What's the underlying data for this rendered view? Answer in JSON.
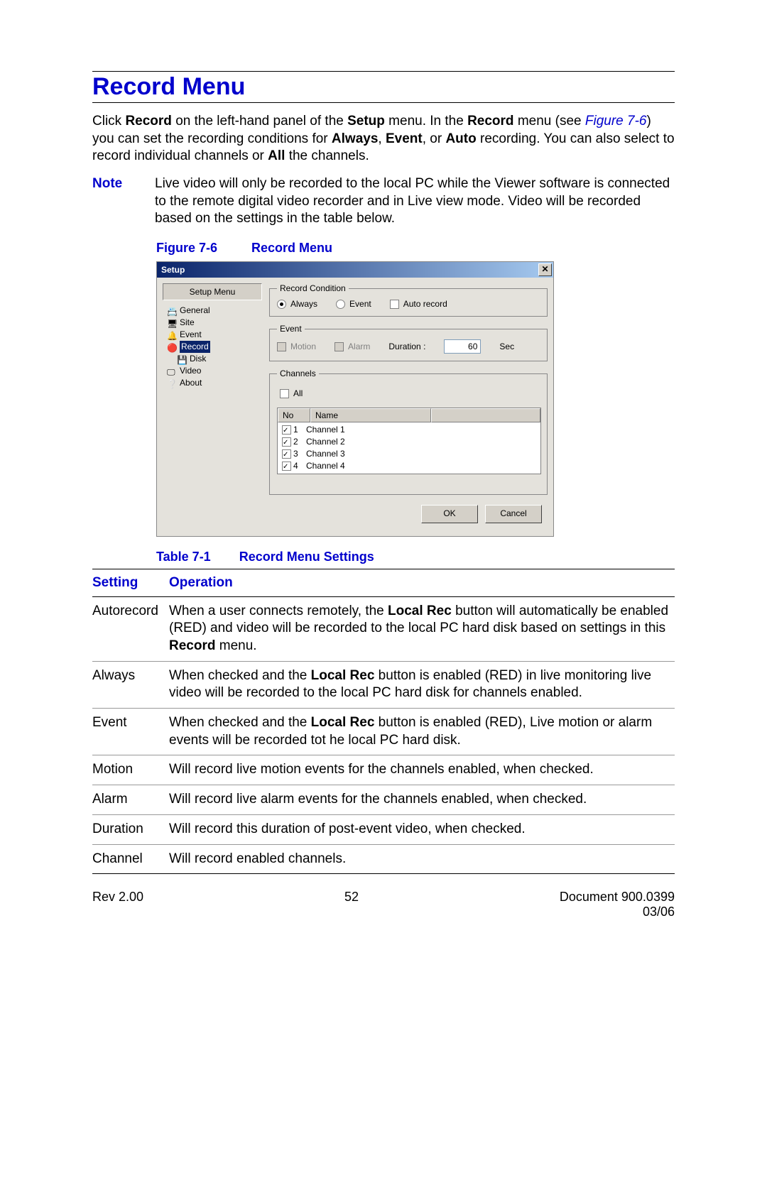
{
  "heading": "Record Menu",
  "intro": {
    "pre": "Click ",
    "b1": "Record",
    "mid1": " on the left-hand panel of the ",
    "b2": "Setup",
    "mid2": " menu. In the ",
    "b3": "Record",
    "mid3": " menu (see ",
    "figref": "Figure 7-6",
    "mid4": ") you can set the recording conditions for ",
    "b4": "Always",
    "c1": ", ",
    "b5": "Event",
    "c2": ", or ",
    "b6": "Auto",
    "mid5": " recording. You can also select to record individual channels or ",
    "b7": "All",
    "end": " the channels."
  },
  "note": {
    "label": "Note",
    "text": "Live video will only be recorded to the local PC while the Viewer software is connected to the remote digital video recorder and in Live view mode. Video will be recorded based on the settings in the table below."
  },
  "figure": {
    "num": "Figure 7-6",
    "title": "Record Menu"
  },
  "dialog": {
    "title": "Setup",
    "menuHeader": "Setup Menu",
    "tree": {
      "general": "General",
      "site": "Site",
      "event": "Event",
      "record": "Record",
      "disk": "Disk",
      "video": "Video",
      "about": "About"
    },
    "groups": {
      "recordCondition": "Record Condition",
      "event": "Event",
      "channels": "Channels"
    },
    "radios": {
      "always": "Always",
      "event": "Event",
      "autorecord": "Auto record"
    },
    "eventOpts": {
      "motion": "Motion",
      "alarm": "Alarm",
      "durationLabel": "Duration :",
      "durationValue": "60",
      "durationUnit": "Sec"
    },
    "channels": {
      "all": "All",
      "headers": {
        "no": "No",
        "name": "Name"
      },
      "rows": [
        {
          "no": "1",
          "name": "Channel 1"
        },
        {
          "no": "2",
          "name": "Channel 2"
        },
        {
          "no": "3",
          "name": "Channel 3"
        },
        {
          "no": "4",
          "name": "Channel 4"
        }
      ]
    },
    "buttons": {
      "ok": "OK",
      "cancel": "Cancel"
    }
  },
  "table": {
    "num": "Table 7-1",
    "title": "Record Menu Settings",
    "headers": {
      "setting": "Setting",
      "operation": "Operation"
    },
    "rows": [
      {
        "setting": "Autorecord",
        "op_pre": "When a user connects remotely, the ",
        "op_b1": "Local Rec",
        "op_mid": " button will automatically be enabled (RED) and video will be recorded to the local PC hard disk based on settings in this ",
        "op_b2": "Record",
        "op_end": " menu."
      },
      {
        "setting": "Always",
        "op_pre": "When checked and the ",
        "op_b1": "Local Rec",
        "op_mid": " button is enabled (RED) in live monitoring live video will be recorded to the local PC hard disk for channels enabled.",
        "op_b2": "",
        "op_end": ""
      },
      {
        "setting": "Event",
        "op_pre": "When checked and the ",
        "op_b1": "Local Rec",
        "op_mid": " button is enabled (RED), Live motion or alarm events will be recorded tot he local PC hard disk.",
        "op_b2": "",
        "op_end": ""
      },
      {
        "setting": "Motion",
        "op_pre": "Will record live motion events for the channels enabled, when checked.",
        "op_b1": "",
        "op_mid": "",
        "op_b2": "",
        "op_end": ""
      },
      {
        "setting": "Alarm",
        "op_pre": "Will record live alarm events for the channels enabled, when checked.",
        "op_b1": "",
        "op_mid": "",
        "op_b2": "",
        "op_end": ""
      },
      {
        "setting": "Duration",
        "op_pre": "Will record this duration of post-event video, when checked.",
        "op_b1": "",
        "op_mid": "",
        "op_b2": "",
        "op_end": ""
      },
      {
        "setting": "Channel",
        "op_pre": "Will record enabled channels.",
        "op_b1": "",
        "op_mid": "",
        "op_b2": "",
        "op_end": ""
      }
    ]
  },
  "footer": {
    "rev": "Rev 2.00",
    "page": "52",
    "doc": "Document 900.0399",
    "date": "03/06"
  }
}
